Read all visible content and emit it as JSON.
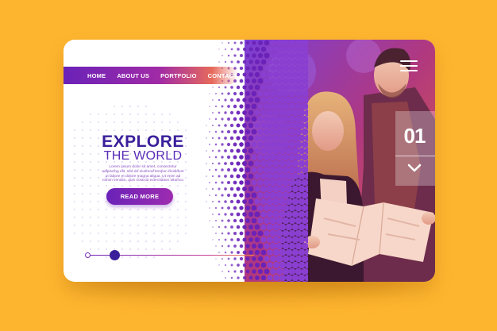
{
  "nav": {
    "items": [
      {
        "label": "HOME"
      },
      {
        "label": "ABOUT US"
      },
      {
        "label": "PORTFOLIO"
      },
      {
        "label": "CONTACT"
      }
    ]
  },
  "hero": {
    "title_line1": "EXPLORE",
    "title_line2": "THE WORLD",
    "body": "Lorem ipsum dolor sit amet, consectetur adipiscing elit, sed do eiusmod tempor incididunt ut labore et dolore magna aliqua. Ut enim ad minim veniam, quis nostrud exercitation ullamco",
    "cta_label": "READ MORE"
  },
  "slider": {
    "slide_number": "01",
    "position": 0.15
  },
  "icons": {
    "menu": "hamburger-menu-icon",
    "next": "chevron-down-icon"
  },
  "colors": {
    "background": "#fdb52f",
    "primary": "#3a1f9a",
    "accent_purple": "#6a22b8",
    "accent_magenta": "#c43b99",
    "accent_orange": "#f08a44"
  }
}
